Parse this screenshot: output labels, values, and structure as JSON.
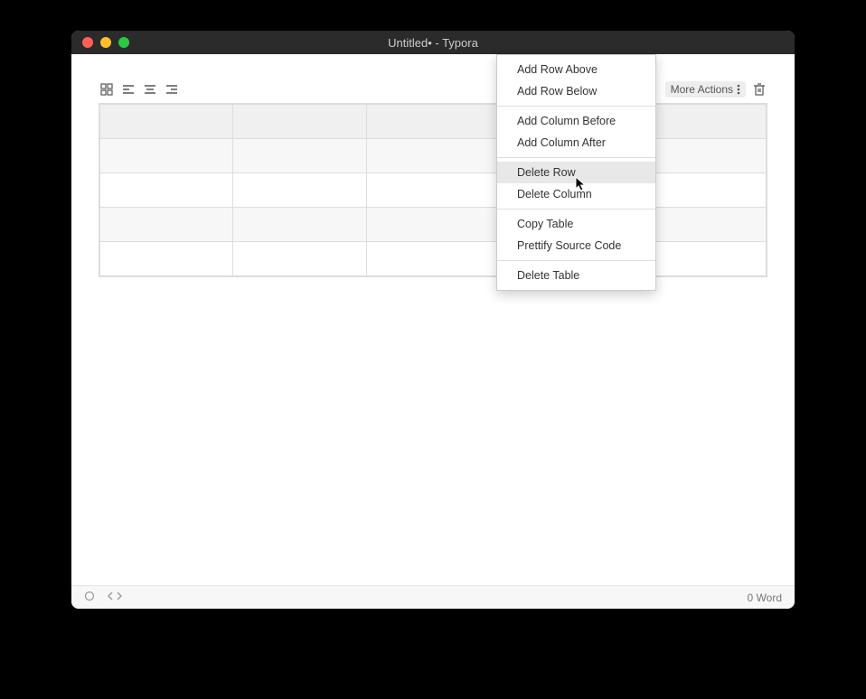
{
  "window": {
    "title": "Untitled• - Typora"
  },
  "toolbar": {
    "more_actions_label": "More Actions"
  },
  "menu": {
    "items": [
      {
        "label": "Add Row Above"
      },
      {
        "label": "Add Row Below"
      },
      {
        "sep": true
      },
      {
        "label": "Add Column Before"
      },
      {
        "label": "Add Column After"
      },
      {
        "sep": true
      },
      {
        "label": "Delete Row",
        "hover": true
      },
      {
        "label": "Delete Column"
      },
      {
        "sep": true
      },
      {
        "label": "Copy Table"
      },
      {
        "label": "Prettify Source Code"
      },
      {
        "sep": true
      },
      {
        "label": "Delete Table"
      }
    ]
  },
  "statusbar": {
    "word_count": "0 Word"
  },
  "table": {
    "rows": 5,
    "cols": 5
  }
}
